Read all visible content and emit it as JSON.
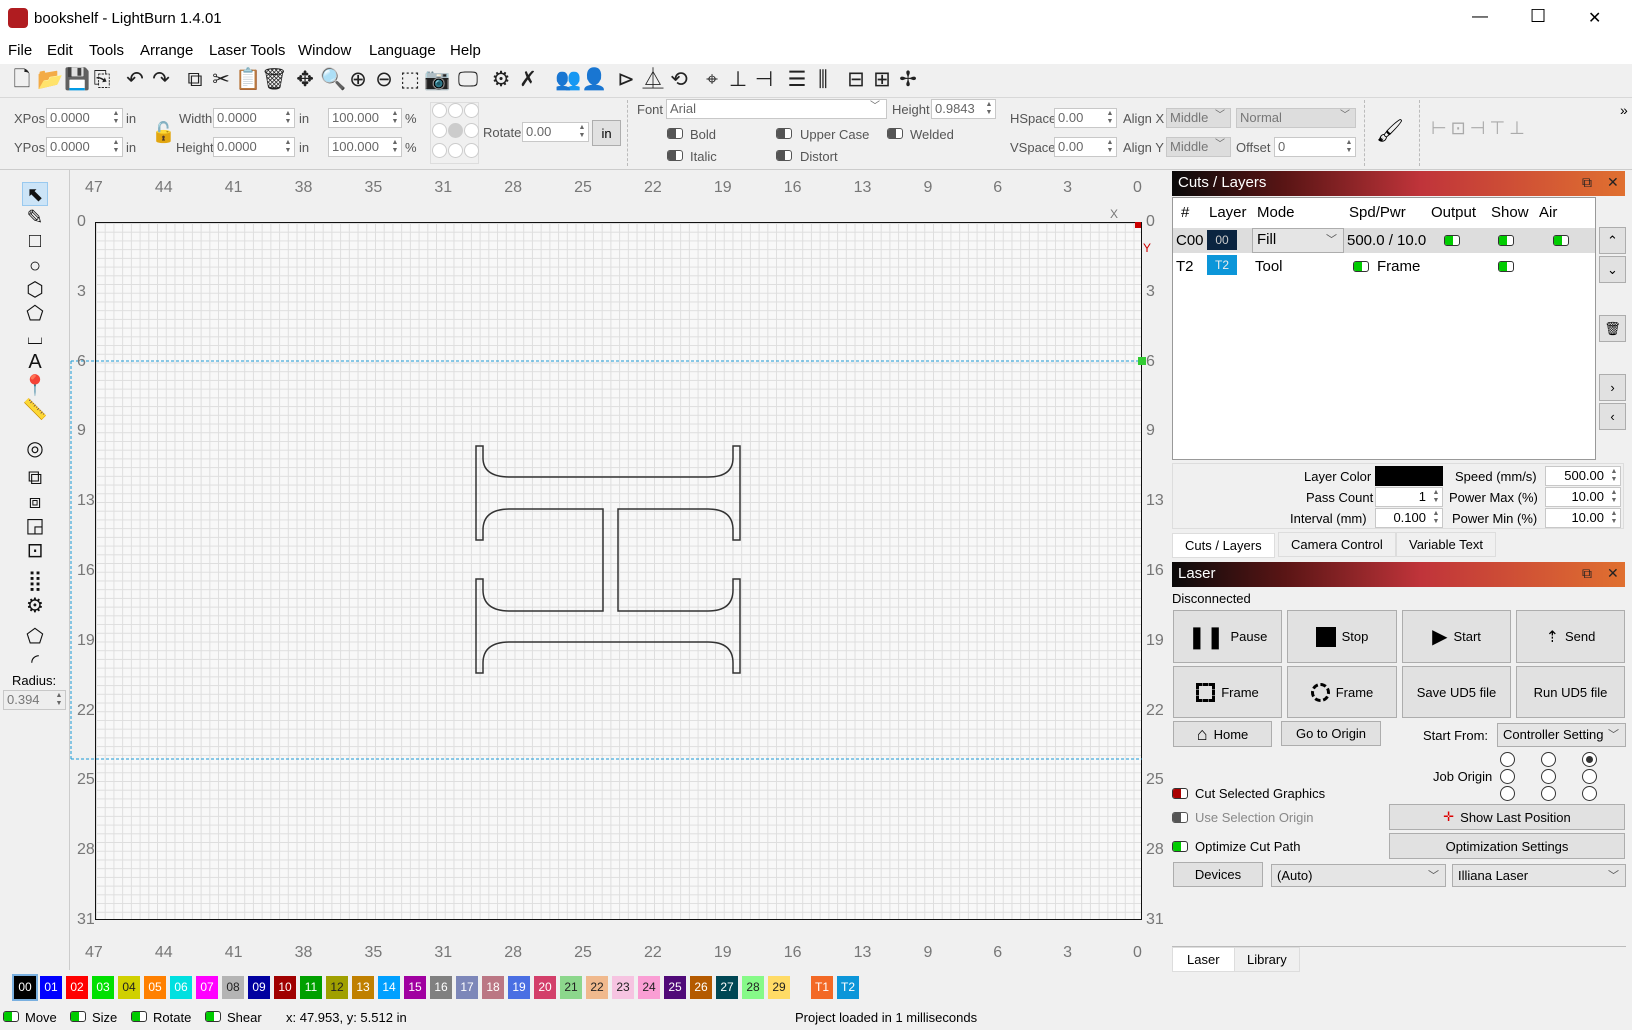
{
  "window": {
    "title": "bookshelf - LightBurn 1.4.01",
    "min": "—",
    "max": "☐",
    "close": "✕"
  },
  "menu": [
    "File",
    "Edit",
    "Tools",
    "Arrange",
    "Laser Tools",
    "Window",
    "Language",
    "Help"
  ],
  "toolbar_icons": [
    "new-file-icon",
    "open-folder-icon",
    "save-icon",
    "import-icon",
    "undo-icon",
    "redo-icon",
    "copy-icon",
    "cut-icon",
    "paste-icon",
    "delete-icon",
    "move-icon",
    "zoom-page-icon",
    "zoom-in-icon",
    "zoom-out-icon",
    "zoom-selection-icon",
    "camera-icon",
    "monitor-icon",
    "settings-icon",
    "device-settings-icon",
    "group-icon",
    "ungroup-icon",
    "mirror-h-icon",
    "mirror-v-icon",
    "rotate-icon",
    "center-icon",
    "align-bottom-icon",
    "align-right-icon",
    "distribute-h-icon",
    "distribute-v-icon",
    "dock-h-icon",
    "dock-v-icon",
    "move-laser-icon"
  ],
  "props": {
    "xpos_label": "XPos",
    "xpos": "0.0000",
    "ypos_label": "YPos",
    "ypos": "0.0000",
    "unit": "in",
    "width_label": "Width",
    "width": "0.0000",
    "height_label": "Height",
    "height": "0.0000",
    "scale_w": "100.000",
    "scale_h": "100.000",
    "pct": "%",
    "rotate_label": "Rotate",
    "rotate": "0.00",
    "unit_button": "in"
  },
  "text_props": {
    "font_label": "Font",
    "font": "Arial",
    "height_label": "Height",
    "height": "0.9843",
    "bold": "Bold",
    "italic": "Italic",
    "upper_case": "Upper Case",
    "distort": "Distort",
    "welded": "Welded",
    "hspace_label": "HSpace",
    "hspace": "0.00",
    "vspace_label": "VSpace",
    "vspace": "0.00",
    "alignx_label": "Align X",
    "alignx": "Middle",
    "aligny_label": "Align Y",
    "aligny": "Middle",
    "mode": "Normal",
    "offset_label": "Offset",
    "offset": "0",
    "more": "»"
  },
  "left_tools": [
    "select-icon",
    "pencil-icon",
    "rectangle-icon",
    "ellipse-icon",
    "polygon-icon",
    "pentagon-icon",
    "frame-icon",
    "text-icon",
    "position-pin-icon",
    "measure-icon",
    "offset-icon",
    "weld-icon",
    "union-icon",
    "subtract-icon",
    "intersect-icon",
    "grid-array-icon",
    "circular-array-icon",
    "node-edit-icon",
    "corner-radius-icon"
  ],
  "radius": {
    "label": "Radius:",
    "value": "0.394"
  },
  "ruler": {
    "top": [
      "47",
      "44",
      "41",
      "38",
      "35",
      "31",
      "28",
      "25",
      "22",
      "19",
      "16",
      "13",
      "9",
      "6",
      "3",
      "0"
    ],
    "left": [
      "0",
      "3",
      "6",
      "9",
      "13",
      "16",
      "19",
      "22",
      "25",
      "28",
      "31"
    ],
    "x_marker": "X",
    "y_marker": "Y"
  },
  "cuts": {
    "title": "Cuts / Layers",
    "headers": [
      "#",
      "Layer",
      "Mode",
      "Spd/Pwr",
      "Output",
      "Show",
      "Air"
    ],
    "rows": [
      {
        "num": "C00",
        "layer": "00",
        "layer_color": "#0a2440",
        "mode": "Fill",
        "spdpwr": "500.0 / 10.0",
        "output": true,
        "show": true,
        "air": true
      },
      {
        "num": "T2",
        "layer": "T2",
        "layer_color": "#0c96d9",
        "mode": "Tool",
        "spdpwr": "Frame",
        "show": true
      }
    ],
    "layer_color_label": "Layer Color",
    "layer_color": "#000000",
    "pass_count_label": "Pass Count",
    "pass_count": "1",
    "interval_label": "Interval (mm)",
    "interval": "0.100",
    "speed_label": "Speed (mm/s)",
    "speed": "500.00",
    "pmax_label": "Power Max (%)",
    "pmax": "10.00",
    "pmin_label": "Power Min (%)",
    "pmin": "10.00",
    "tabs": [
      "Cuts / Layers",
      "Camera Control",
      "Variable Text"
    ]
  },
  "laser": {
    "title": "Laser",
    "status": "Disconnected",
    "pause": "Pause",
    "stop": "Stop",
    "start": "Start",
    "send": "Send",
    "frame1": "Frame",
    "frame2": "Frame",
    "save_ud5": "Save UD5 file",
    "run_ud5": "Run UD5 file",
    "home": "Home",
    "go_origin": "Go to Origin",
    "start_from_label": "Start From:",
    "start_from": "Controller Setting",
    "job_origin_label": "Job Origin",
    "job_origin_selected": "top-right",
    "cut_selected": "Cut Selected Graphics",
    "use_sel_origin": "Use Selection Origin",
    "optimize": "Optimize Cut Path",
    "show_last": "Show Last Position",
    "opt_settings": "Optimization Settings",
    "devices": "Devices",
    "port": "(Auto)",
    "device": "Illiana Laser",
    "tabs": [
      "Laser",
      "Library"
    ]
  },
  "palette": [
    [
      "00",
      "#000000"
    ],
    [
      "01",
      "#0000ff"
    ],
    [
      "02",
      "#ff0000"
    ],
    [
      "03",
      "#00e000"
    ],
    [
      "04",
      "#d0d000"
    ],
    [
      "05",
      "#ff8000"
    ],
    [
      "06",
      "#00e0e0"
    ],
    [
      "07",
      "#ff00ff"
    ],
    [
      "08",
      "#b4b4b4"
    ],
    [
      "09",
      "#0000a0"
    ],
    [
      "10",
      "#a00000"
    ],
    [
      "11",
      "#00a000"
    ],
    [
      "12",
      "#a0a000"
    ],
    [
      "13",
      "#c08000"
    ],
    [
      "14",
      "#00a0ff"
    ],
    [
      "15",
      "#a000a0"
    ],
    [
      "16",
      "#808080"
    ],
    [
      "17",
      "#7d87b9"
    ],
    [
      "18",
      "#bb7784"
    ],
    [
      "19",
      "#4a6fe3"
    ],
    [
      "20",
      "#d33f6a"
    ],
    [
      "21",
      "#8cd78c"
    ],
    [
      "22",
      "#f0b98d"
    ],
    [
      "23",
      "#f6c4e1"
    ],
    [
      "24",
      "#fa9ed4"
    ],
    [
      "25",
      "#500a78"
    ],
    [
      "26",
      "#b45a00"
    ],
    [
      "27",
      "#004754"
    ],
    [
      "28",
      "#86fa88"
    ],
    [
      "29",
      "#ffdb66"
    ],
    [
      "T1",
      "#f36926"
    ],
    [
      "T2",
      "#0c96d9"
    ]
  ],
  "status": {
    "move": "Move",
    "size": "Size",
    "rotate": "Rotate",
    "shear": "Shear",
    "coords": "x: 47.953, y: 5.512 in",
    "message": "Project loaded in 1 milliseconds"
  }
}
